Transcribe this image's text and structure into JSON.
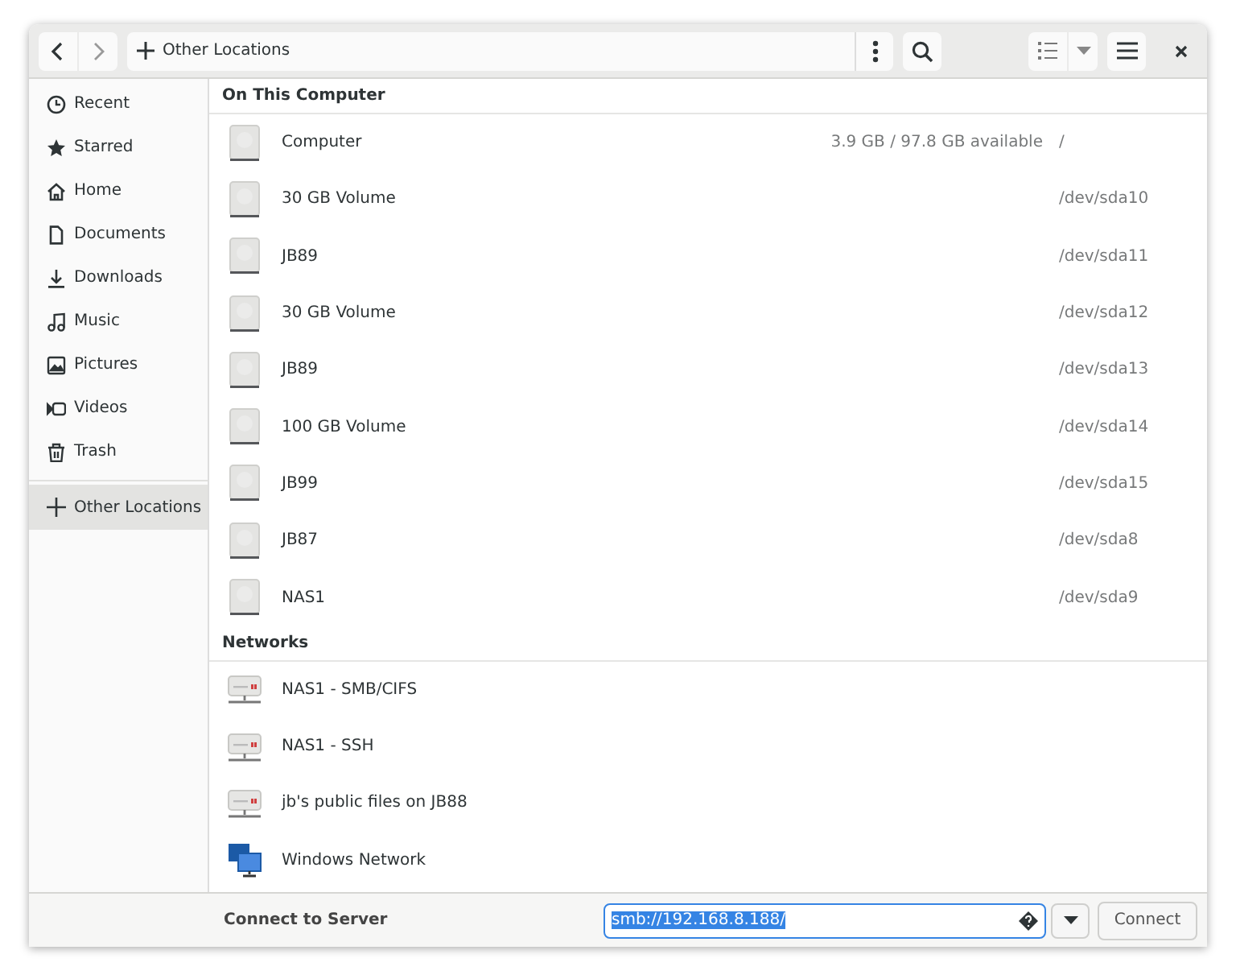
{
  "header": {
    "location": "Other Locations"
  },
  "sidebar": {
    "items": [
      {
        "label": "Recent",
        "selected": false
      },
      {
        "label": "Starred",
        "selected": false
      },
      {
        "label": "Home",
        "selected": false
      },
      {
        "label": "Documents",
        "selected": false
      },
      {
        "label": "Downloads",
        "selected": false
      },
      {
        "label": "Music",
        "selected": false
      },
      {
        "label": "Pictures",
        "selected": false
      },
      {
        "label": "Videos",
        "selected": false
      },
      {
        "label": "Trash",
        "selected": false
      },
      {
        "label": "Other Locations",
        "selected": true
      }
    ]
  },
  "sections": [
    {
      "title": "On This Computer",
      "items": [
        {
          "name": "Computer",
          "kind": "disk",
          "info": "3.9 GB / 97.8 GB available",
          "path": "/"
        },
        {
          "name": "30 GB Volume",
          "kind": "disk",
          "path": "/dev/sda10"
        },
        {
          "name": "JB89",
          "kind": "disk",
          "path": "/dev/sda11"
        },
        {
          "name": "30 GB Volume",
          "kind": "disk",
          "path": "/dev/sda12"
        },
        {
          "name": "JB89",
          "kind": "disk",
          "path": "/dev/sda13"
        },
        {
          "name": "100 GB Volume",
          "kind": "disk",
          "path": "/dev/sda14"
        },
        {
          "name": "JB99",
          "kind": "disk",
          "path": "/dev/sda15"
        },
        {
          "name": "JB87",
          "kind": "disk",
          "path": "/dev/sda8"
        },
        {
          "name": "NAS1",
          "kind": "disk",
          "path": "/dev/sda9"
        }
      ]
    },
    {
      "title": "Networks",
      "items": [
        {
          "name": "NAS1 - SMB/CIFS",
          "kind": "server"
        },
        {
          "name": "NAS1 - SSH",
          "kind": "server"
        },
        {
          "name": "jb's public files on JB88",
          "kind": "server"
        },
        {
          "name": "Windows Network",
          "kind": "windows"
        }
      ]
    }
  ],
  "connect": {
    "label": "Connect to Server",
    "value": "smb://192.168.8.188/",
    "button": "Connect"
  }
}
